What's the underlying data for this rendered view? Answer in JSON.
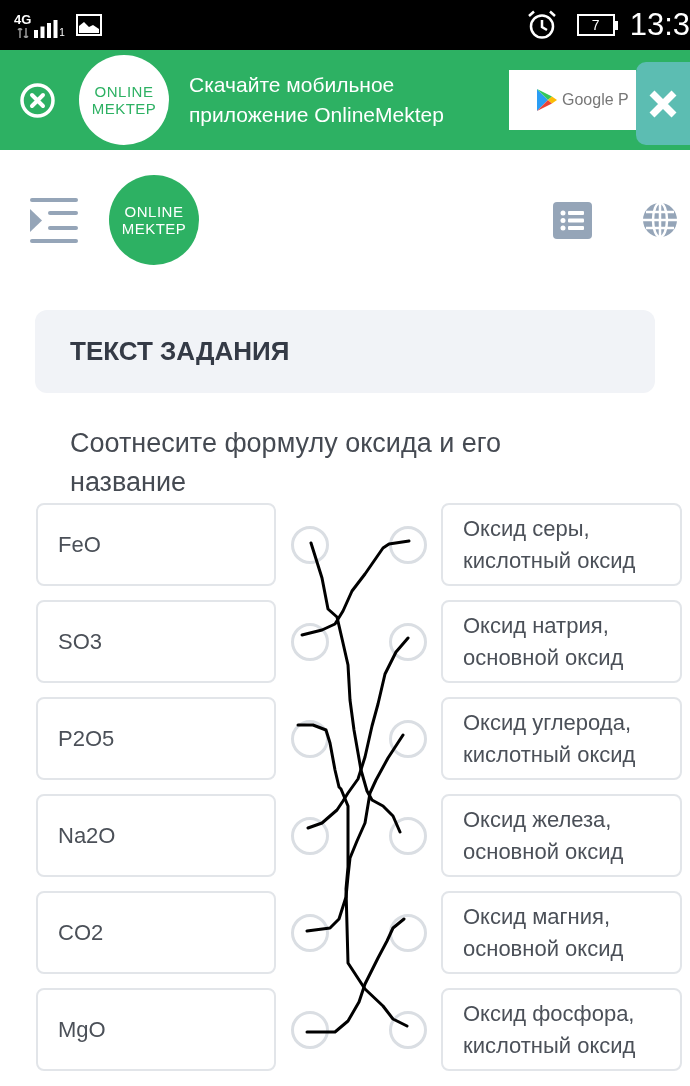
{
  "status_bar": {
    "network": "4G",
    "sim_slot": "1",
    "battery": "7",
    "time": "13:3"
  },
  "app_banner": {
    "logo_lines": [
      "ONLINE",
      "MEKTEP"
    ],
    "message": "Скачайте мобильное приложение OnlineMektep",
    "store_button": "Google P"
  },
  "header": {
    "logo_lines": [
      "ONLINE",
      "MEKTEP"
    ]
  },
  "task": {
    "heading": "ТЕКСТ ЗАДАНИЯ",
    "question": "Соотнесите формулу оксида и его название"
  },
  "matching": {
    "left": [
      "FeO",
      "SO3",
      "P2O5",
      "Na2O",
      "CO2",
      "MgO"
    ],
    "right": [
      "Оксид серы, кислотный оксид",
      "Оксид натрия, основной оксид",
      "Оксид углерода, кислотный оксид",
      "Оксид железа, основной оксид",
      "Оксид магния, основной оксид",
      "Оксид фосфора, кислотный оксид"
    ]
  }
}
